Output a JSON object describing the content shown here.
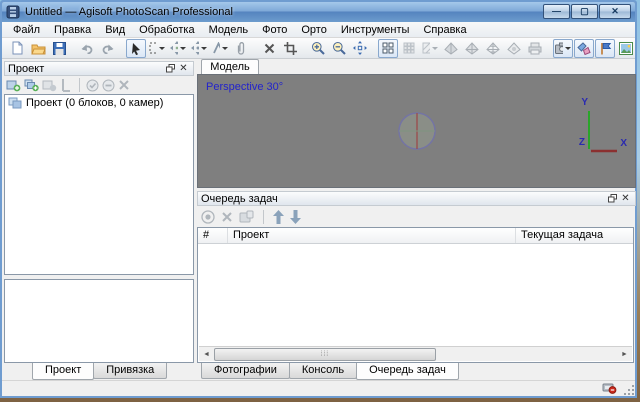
{
  "window": {
    "title": "Untitled — Agisoft PhotoScan Professional"
  },
  "menu": {
    "items": [
      "Файл",
      "Правка",
      "Вид",
      "Обработка",
      "Модель",
      "Фото",
      "Орто",
      "Инструменты",
      "Справка"
    ]
  },
  "toolbar": {
    "icons": [
      "new-document",
      "open-folder",
      "save",
      "undo",
      "redo",
      "select-arrow",
      "rectangle-selection",
      "move-region",
      "move-object",
      "measure",
      "attach",
      "delete",
      "crop",
      "zoom-in",
      "zoom-out",
      "reset-view",
      "grid-4-view",
      "grid-9-view",
      "hatch-pattern",
      "shaded-diamond-1",
      "shaded-diamond-2",
      "shaded-diamond-3",
      "shaded-diamond-4",
      "print",
      "camera",
      "shapes",
      "flag",
      "image",
      "stack"
    ]
  },
  "project_panel": {
    "title": "Проект",
    "toolbar_icons": [
      "add-chunk",
      "add-photos",
      "add-marker-disabled",
      "add-scalebar-disabled",
      "enable-disabled",
      "disable-disabled",
      "remove-disabled"
    ],
    "tree_items": [
      {
        "label": "Проект (0 блоков, 0 камер)"
      }
    ],
    "tabs": [
      {
        "label": "Проект",
        "active": true
      },
      {
        "label": "Привязка",
        "active": false
      }
    ]
  },
  "model_view": {
    "tab_label": "Модель",
    "overlay_label": "Perspective 30°",
    "axis_labels": {
      "x": "X",
      "y": "Y",
      "z": "Z"
    }
  },
  "task_queue": {
    "title": "Очередь задач",
    "toolbar_icons": [
      "run-disabled",
      "cancel-disabled",
      "export-disabled",
      "move-up-disabled",
      "move-down-disabled"
    ],
    "columns": [
      "#",
      "Проект",
      "Текущая задача"
    ],
    "rows": [],
    "tabs": [
      {
        "label": "Фотографии",
        "active": false
      },
      {
        "label": "Консоль",
        "active": false
      },
      {
        "label": "Очередь задач",
        "active": true
      }
    ]
  },
  "colors": {
    "titlebar_blue": "#5584bf",
    "viewport_gray": "#7f7f7f",
    "overlay_text": "#2323cc",
    "axis_x_red": "#8b3030",
    "axis_y_green": "#2aa52a",
    "pressed_border": "#89a8cd"
  }
}
